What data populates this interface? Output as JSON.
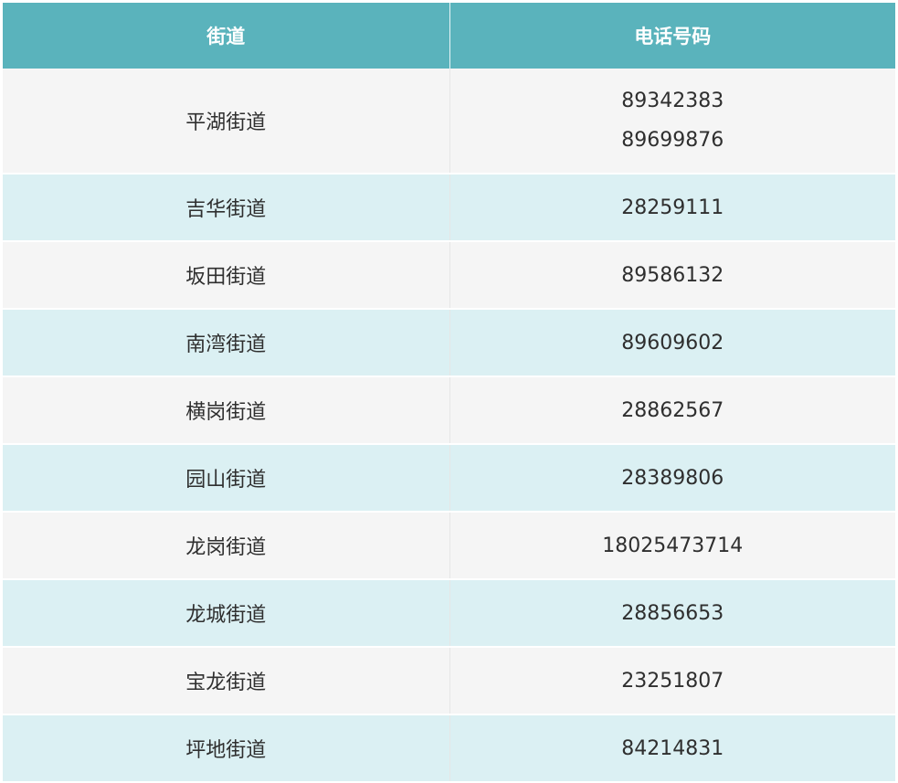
{
  "header": {
    "street": "街道",
    "phone": "电话号码"
  },
  "rows": [
    {
      "street": "平湖街道",
      "phones": [
        "89342383",
        "89699876"
      ]
    },
    {
      "street": "吉华街道",
      "phones": [
        "28259111"
      ]
    },
    {
      "street": "坂田街道",
      "phones": [
        "89586132"
      ]
    },
    {
      "street": "南湾街道",
      "phones": [
        "89609602"
      ]
    },
    {
      "street": "横岗街道",
      "phones": [
        "28862567"
      ]
    },
    {
      "street": "园山街道",
      "phones": [
        "28389806"
      ]
    },
    {
      "street": "龙岗街道",
      "phones": [
        "18025473714"
      ]
    },
    {
      "street": "龙城街道",
      "phones": [
        "28856653"
      ]
    },
    {
      "street": "宝龙街道",
      "phones": [
        "23251807"
      ]
    },
    {
      "street": "坪地街道",
      "phones": [
        "84214831"
      ]
    }
  ],
  "colors": {
    "header_bg": "#5ab3bc",
    "row_odd_bg": "#f5f5f5",
    "row_even_bg": "#dbf0f3"
  }
}
